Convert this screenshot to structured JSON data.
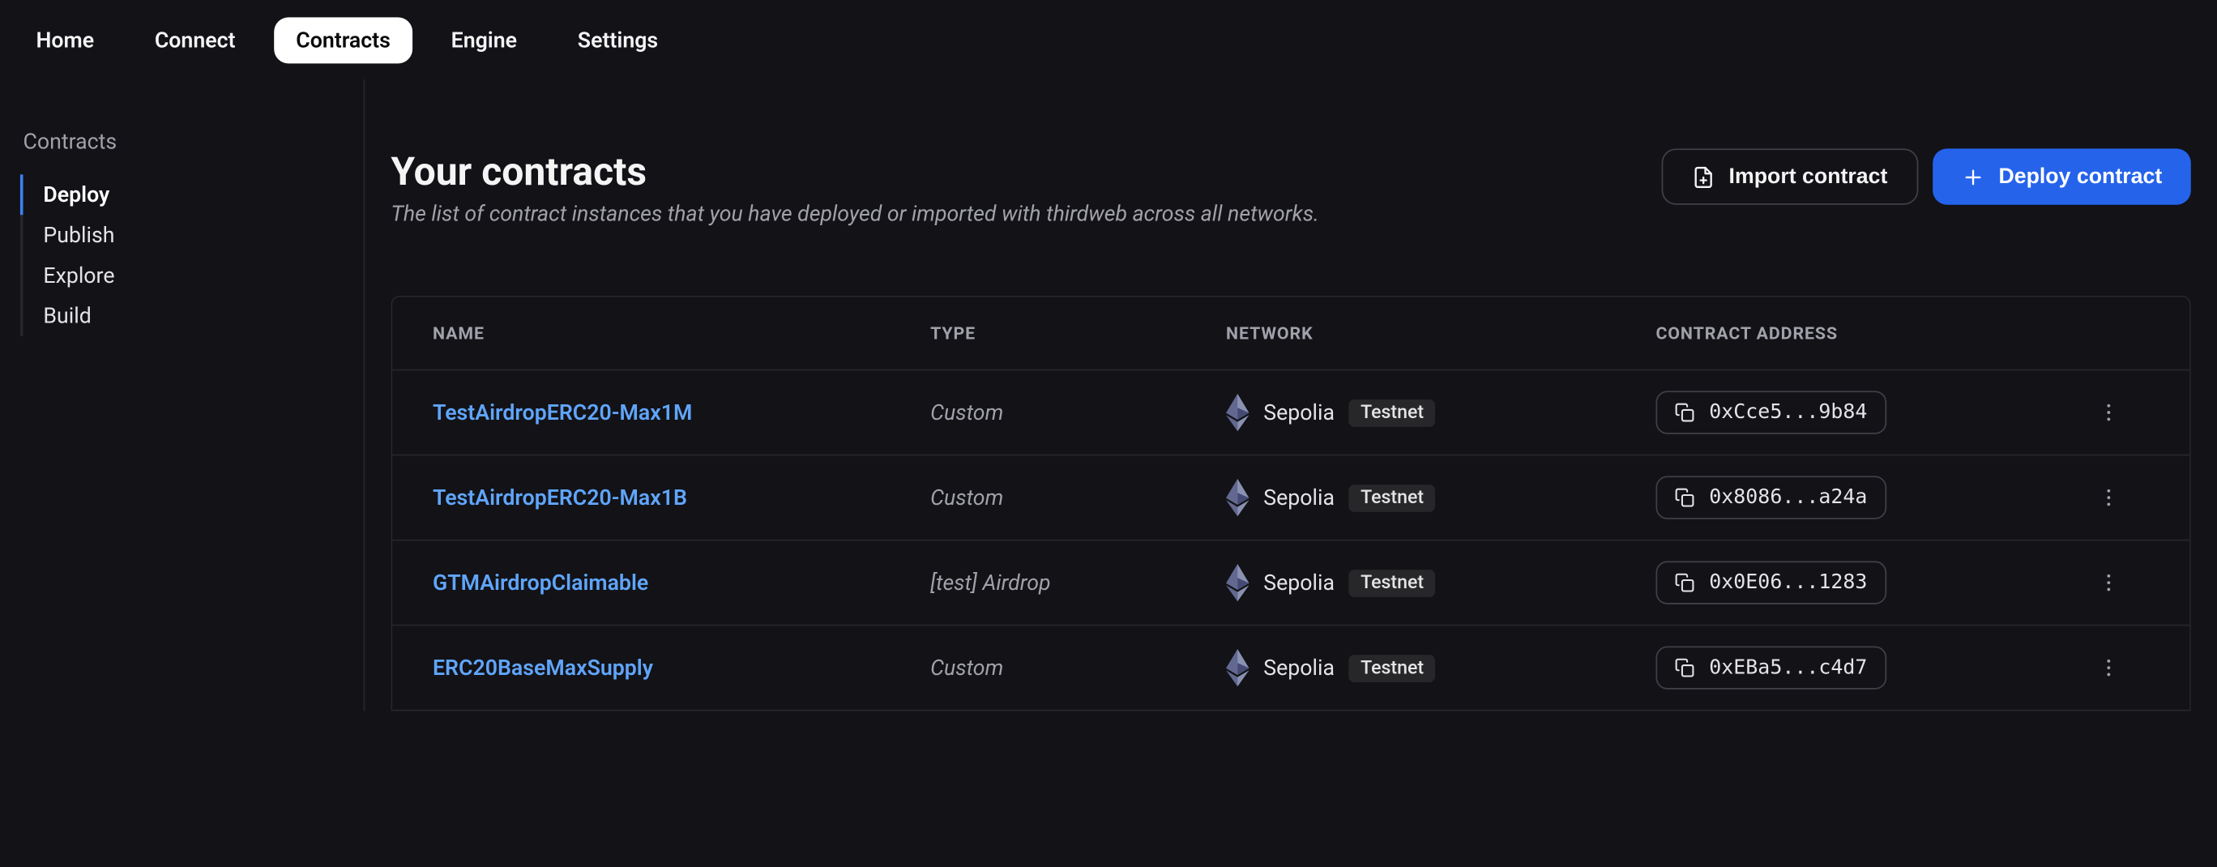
{
  "topnav": {
    "items": [
      {
        "label": "Home"
      },
      {
        "label": "Connect"
      },
      {
        "label": "Contracts"
      },
      {
        "label": "Engine"
      },
      {
        "label": "Settings"
      }
    ],
    "active_index": 2
  },
  "sidebar": {
    "title": "Contracts",
    "items": [
      {
        "label": "Deploy"
      },
      {
        "label": "Publish"
      },
      {
        "label": "Explore"
      },
      {
        "label": "Build"
      }
    ],
    "active_index": 0
  },
  "header": {
    "title": "Your contracts",
    "subtitle": "The list of contract instances that you have deployed or imported with thirdweb across all networks.",
    "import_label": "Import contract",
    "deploy_label": "Deploy contract"
  },
  "table": {
    "columns": [
      "NAME",
      "TYPE",
      "NETWORK",
      "CONTRACT ADDRESS"
    ],
    "rows": [
      {
        "name": "TestAirdropERC20-Max1M",
        "type": "Custom",
        "network": "Sepolia",
        "net_badge": "Testnet",
        "address": "0xCce5...9b84"
      },
      {
        "name": "TestAirdropERC20-Max1B",
        "type": "Custom",
        "network": "Sepolia",
        "net_badge": "Testnet",
        "address": "0x8086...a24a"
      },
      {
        "name": "GTMAirdropClaimable",
        "type": "[test] Airdrop",
        "network": "Sepolia",
        "net_badge": "Testnet",
        "address": "0x0E06...1283"
      },
      {
        "name": "ERC20BaseMaxSupply",
        "type": "Custom",
        "network": "Sepolia",
        "net_badge": "Testnet",
        "address": "0xEBa5...c4d7"
      }
    ]
  }
}
